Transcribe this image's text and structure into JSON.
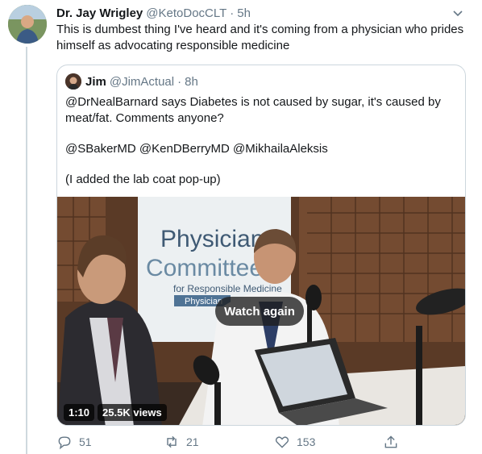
{
  "tweet": {
    "author_name": "Dr. Jay Wrigley",
    "author_handle": "@KetoDocCLT",
    "separator": "·",
    "time": "5h",
    "text": "This is dumbest thing I've heard and it's coming from a physician who prides himself as advocating responsible medicine"
  },
  "quote": {
    "author_name": "Jim",
    "author_handle": "@JimActual",
    "separator": "·",
    "time": "8h",
    "lines": [
      "@DrNealBarnard says Diabetes is not caused by sugar, it's caused by meat/fat.  Comments anyone?",
      "@SBakerMD @KenDBerryMD @MikhailaAleksis",
      "(I added the lab coat pop-up)"
    ],
    "video": {
      "banner_line1": "Physicians",
      "banner_line2": "Committee",
      "banner_line3": "for Responsible Medicine",
      "banner_line4": "Physician",
      "watch_again_label": "Watch again",
      "duration": "1:10",
      "views": "25.5K views"
    }
  },
  "actions": {
    "reply_count": "51",
    "retweet_count": "21",
    "like_count": "153"
  },
  "colors": {
    "text_primary": "#14171a",
    "text_secondary": "#657786",
    "border": "#ccd6dd"
  },
  "icons": {
    "reply": "reply-icon",
    "retweet": "retweet-icon",
    "like": "heart-icon",
    "share": "share-icon",
    "caret": "chevron-down-icon"
  }
}
